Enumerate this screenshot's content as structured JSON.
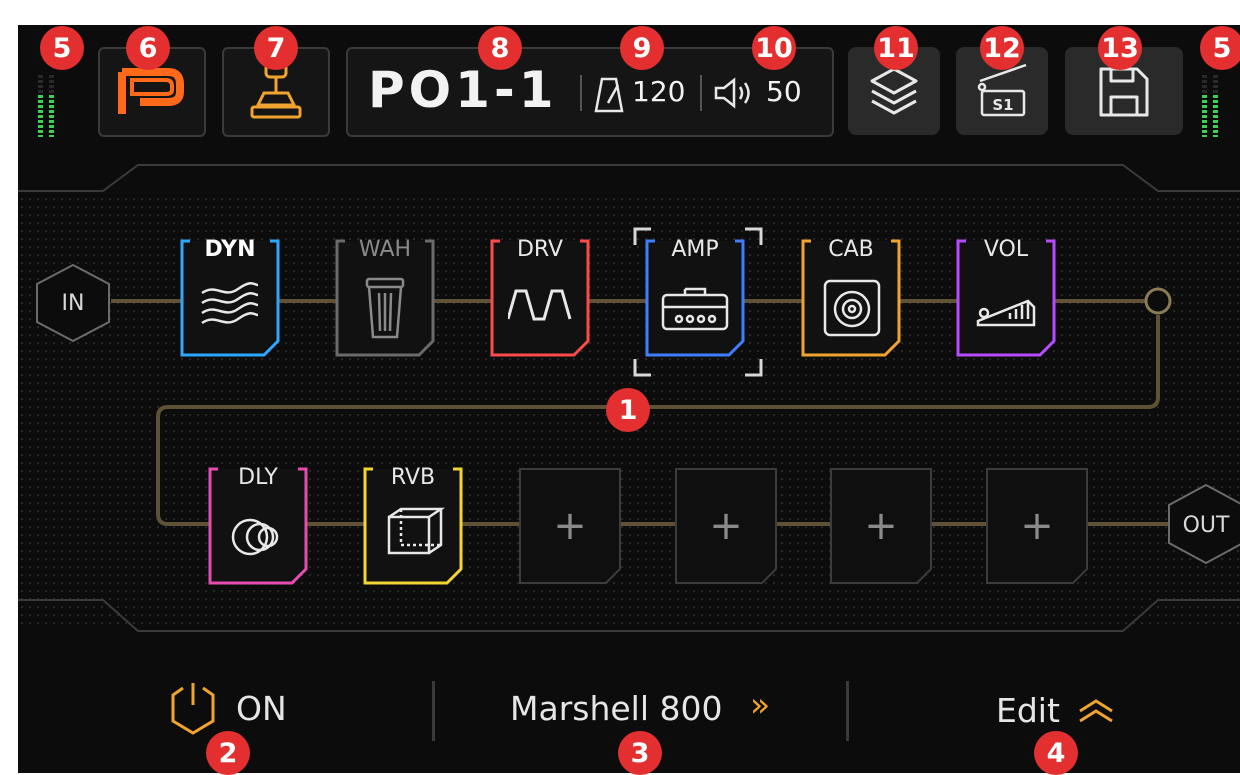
{
  "header": {
    "preset_name": "PO1-1",
    "tempo": "120",
    "volume": "50"
  },
  "chain": {
    "input_label": "IN",
    "output_label": "OUT",
    "blocks": [
      {
        "label": "DYN",
        "color": "#2ea7ff",
        "icon": "dynamics-wave-icon"
      },
      {
        "label": "WAH",
        "color": "#6a6a6a",
        "icon": "wah-pedal-icon"
      },
      {
        "label": "DRV",
        "color": "#ff4a4a",
        "icon": "drive-square-wave-icon"
      },
      {
        "label": "AMP",
        "color": "#3f7dff",
        "icon": "amp-head-icon"
      },
      {
        "label": "CAB",
        "color": "#f0a32e",
        "icon": "cabinet-speaker-icon"
      },
      {
        "label": "VOL",
        "color": "#b74bff",
        "icon": "volume-pedal-icon"
      },
      {
        "label": "DLY",
        "color": "#e64bb0",
        "icon": "delay-circles-icon"
      },
      {
        "label": "RVB",
        "color": "#f2d534",
        "icon": "reverb-cube-icon"
      }
    ],
    "empty_slot_symbol": "+"
  },
  "bottom_bar": {
    "power_state": "ON",
    "model_name": "Marshell 800",
    "model_arrow": "»",
    "edit_label": "Edit"
  },
  "badges": [
    "1",
    "2",
    "3",
    "4",
    "5",
    "6",
    "7",
    "8",
    "9",
    "10",
    "11",
    "12",
    "13",
    "5"
  ],
  "colors": {
    "accent_orange": "#ff6a1a",
    "line": "#6b5a3a",
    "badge": "#e32f2f",
    "meter_green": "#39d353"
  }
}
